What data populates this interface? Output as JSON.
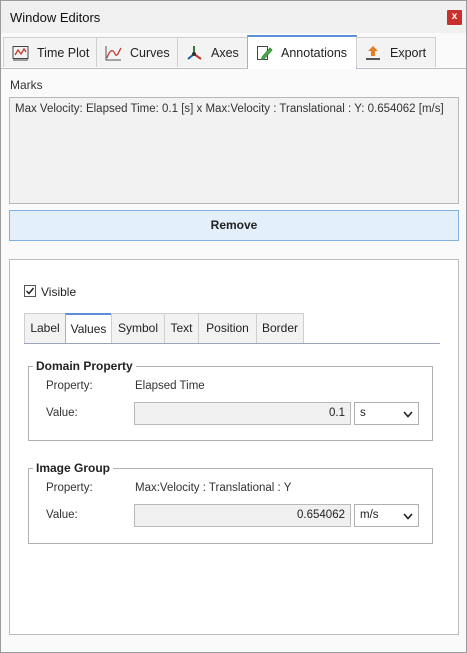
{
  "window": {
    "title": "Window Editors",
    "close_label": "x"
  },
  "tabs": [
    {
      "label": "Time Plot",
      "icon": "time-plot-icon"
    },
    {
      "label": "Curves",
      "icon": "curves-icon"
    },
    {
      "label": "Axes",
      "icon": "axes-icon"
    },
    {
      "label": "Annotations",
      "icon": "annotations-icon",
      "active": true
    },
    {
      "label": "Export",
      "icon": "export-icon"
    }
  ],
  "marks": {
    "label": "Marks",
    "items": [
      "Max Velocity: Elapsed Time: 0.1 [s] x Max:Velocity : Translational : Y: 0.654062 [m/s]"
    ]
  },
  "remove_label": "Remove",
  "visible": {
    "label": "Visible",
    "checked": true
  },
  "subtabs": [
    "Label",
    "Values",
    "Symbol",
    "Text",
    "Position",
    "Border"
  ],
  "domain": {
    "title": "Domain Property",
    "property_label": "Property:",
    "property_value": "Elapsed Time",
    "value_label": "Value:",
    "value": "0.1",
    "unit": "s"
  },
  "image": {
    "title": "Image Group",
    "property_label": "Property:",
    "property_value": "Max:Velocity : Translational : Y",
    "value_label": "Value:",
    "value": "0.654062",
    "unit": "m/s"
  },
  "colors": {
    "accent": "#5b8fd6",
    "close": "#c8312b",
    "remove_bg": "#e3f0fb"
  }
}
